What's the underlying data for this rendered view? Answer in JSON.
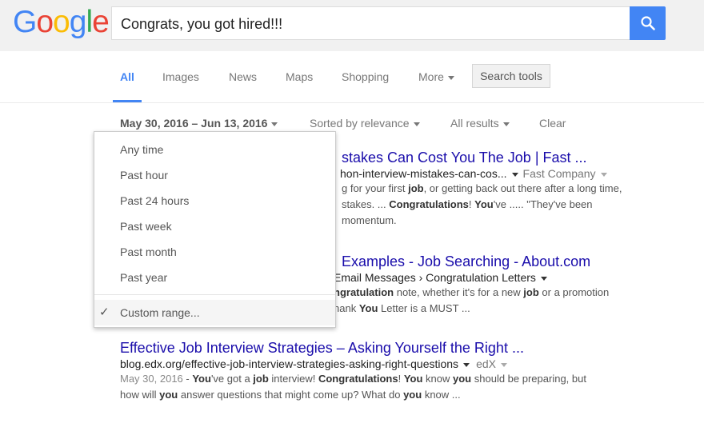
{
  "logo": [
    "G",
    "o",
    "o",
    "g",
    "l",
    "e"
  ],
  "search": {
    "query": "Congrats, you got hired!!!"
  },
  "tabs": [
    {
      "label": "All"
    },
    {
      "label": "Images"
    },
    {
      "label": "News"
    },
    {
      "label": "Maps"
    },
    {
      "label": "Shopping"
    },
    {
      "label": "More"
    }
  ],
  "search_tools_label": "Search tools",
  "toolbar": {
    "date_range": "May 30, 2016 – Jun 13, 2016",
    "sort": "Sorted by relevance",
    "results_filter": "All results",
    "clear": "Clear"
  },
  "time_menu": {
    "items": [
      "Any time",
      "Past hour",
      "Past 24 hours",
      "Past week",
      "Past month",
      "Past year"
    ],
    "custom": "Custom range...",
    "check": "✓"
  },
  "results": [
    {
      "title": "stakes Can Cost You The Job | Fast ...",
      "url": "hon-interview-mistakes-can-cos...",
      "source": "Fast Company",
      "snippet_lines": [
        "g for your first job, or getting back out there after a long time,",
        "stakes. ... Congratulations! You've ..... \"They've been",
        "momentum."
      ]
    },
    {
      "title": "Examples - Job Searching - About.com",
      "url": "Email Messages › Congratulation Letters",
      "snippet_lines": [
        "ngratulation note, whether it's for a new job or a promotion",
        "hank You Letter is a MUST ..."
      ]
    },
    {
      "title": "Effective Job Interview Strategies – Asking Yourself the Right ...",
      "url": "blog.edx.org/effective-job-interview-strategies-asking-right-questions",
      "source": "edX",
      "date": "May 30, 2016",
      "snippet_lines": [
        " - You've got a job interview! Congratulations! You know you should be preparing, but",
        "how will you answer questions that might come up? What do you know ..."
      ]
    }
  ]
}
